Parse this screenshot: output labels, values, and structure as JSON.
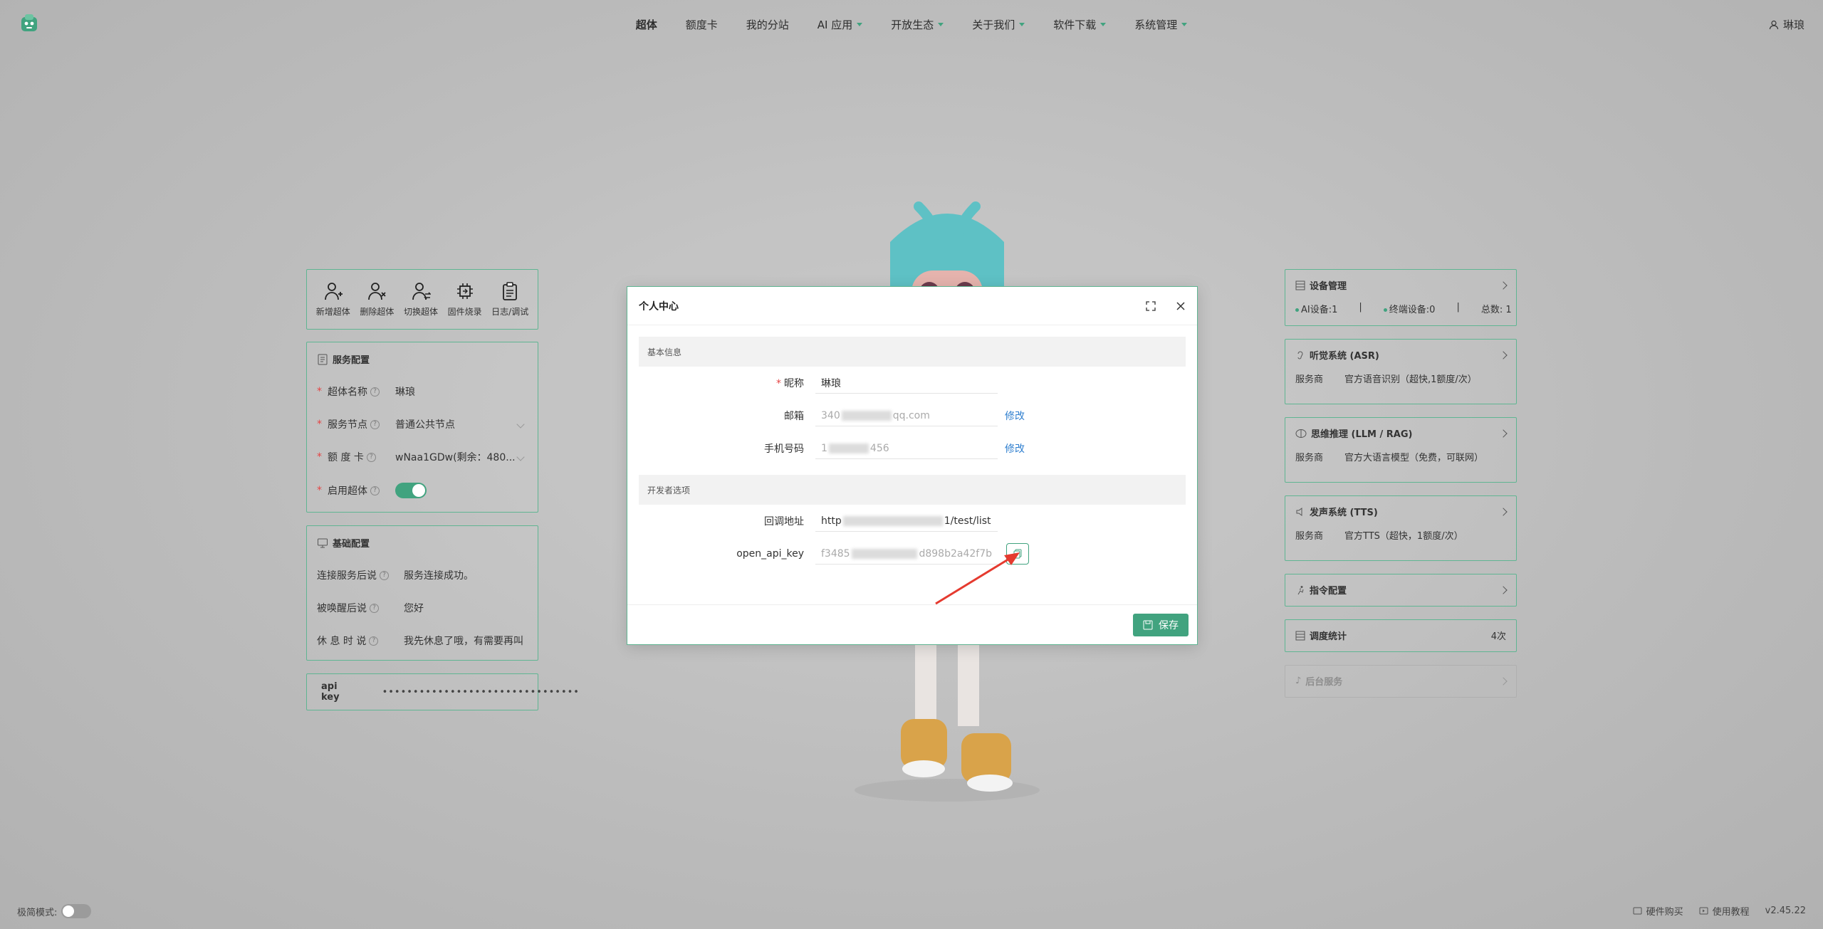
{
  "nav": {
    "items": [
      {
        "label": "超体",
        "active": true,
        "dropdown": false
      },
      {
        "label": "额度卡",
        "dropdown": false
      },
      {
        "label": "我的分站",
        "dropdown": false
      },
      {
        "label": "AI 应用",
        "dropdown": true
      },
      {
        "label": "开放生态",
        "dropdown": true
      },
      {
        "label": "关于我们",
        "dropdown": true
      },
      {
        "label": "软件下载",
        "dropdown": true
      },
      {
        "label": "系统管理",
        "dropdown": true
      }
    ],
    "user": "琳琅"
  },
  "toolbar": {
    "items": [
      {
        "label": "新增超体",
        "icon": "user-add-icon"
      },
      {
        "label": "删除超体",
        "icon": "user-remove-icon"
      },
      {
        "label": "切换超体",
        "icon": "user-switch-icon"
      },
      {
        "label": "固件烧录",
        "icon": "chip-icon"
      },
      {
        "label": "日志/调试",
        "icon": "clipboard-icon"
      }
    ]
  },
  "service_config": {
    "title": "服务配置",
    "name_label": "超体名称",
    "name_value": "琳琅",
    "node_label": "服务节点",
    "node_value": "普通公共节点",
    "card_label": "额 度 卡",
    "card_value": "wNaa1GDw(剩余：480...",
    "enable_label": "启用超体",
    "enabled": true
  },
  "basic_config": {
    "title": "基础配置",
    "connect_label": "连接服务后说",
    "connect_value": "服务连接成功。",
    "wake_label": "被唤醒后说",
    "wake_value": "您好",
    "rest_label": "休 息 时 说",
    "rest_value": "我先休息了哦，有需要再叫"
  },
  "api_key_panel": {
    "label": "api key",
    "masked": "••••••••••••••••••••••••••••••••"
  },
  "right": {
    "device": {
      "title": "设备管理",
      "ai_devices": "AI设备:1",
      "terminals": "终端设备:0",
      "total": "总数: 1",
      "sep": "|"
    },
    "asr": {
      "title": "听觉系统 (ASR)",
      "label": "服务商",
      "value": "官方语音识别（超快,1额度/次）"
    },
    "llm": {
      "title": "思维推理 (LLM / RAG)",
      "label": "服务商",
      "value": "官方大语言模型（免费，可联网）"
    },
    "tts": {
      "title": "发声系统 (TTS)",
      "label": "服务商",
      "value": "官方TTS（超快，1额度/次）"
    },
    "cmd": {
      "title": "指令配置"
    },
    "stats": {
      "title": "调度统计",
      "value": "4次"
    },
    "bg": {
      "title": "后台服务"
    }
  },
  "modal": {
    "title": "个人中心",
    "section_basic": "基本信息",
    "nickname_label": "昵称",
    "nickname_value": "琳琅",
    "email_label": "邮箱",
    "email_prefix": "340",
    "email_suffix": "qq.com",
    "email_action": "修改",
    "phone_label": "手机号码",
    "phone_prefix": "1",
    "phone_suffix": "456",
    "phone_action": "修改",
    "section_dev": "开发者选项",
    "callback_label": "回调地址",
    "callback_prefix": "http",
    "callback_suffix": "1/test/list",
    "key_label": "open_api_key",
    "key_prefix": "f3485",
    "key_suffix": "d898b2a42f7b",
    "save": "保存"
  },
  "footer": {
    "minimal_mode": "极简模式:",
    "hardware": "硬件购买",
    "tutorial": "使用教程",
    "version": "v2.45.22"
  }
}
